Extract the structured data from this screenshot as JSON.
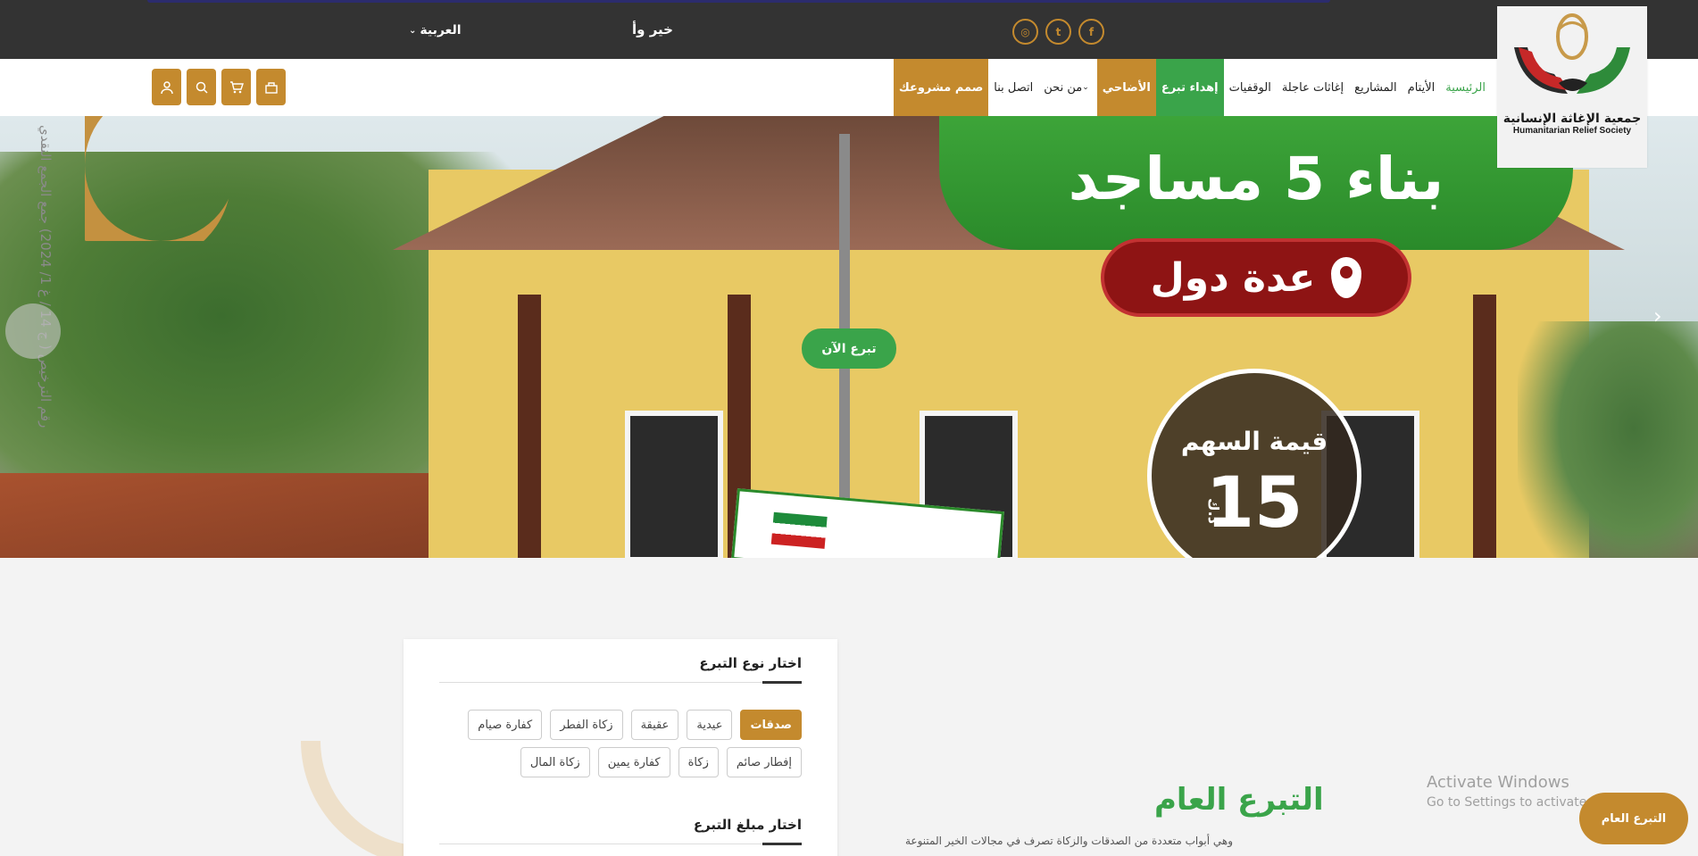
{
  "topbar": {
    "language": "العربية",
    "slogan": "خير وأ",
    "social": [
      {
        "icon": "facebook-icon",
        "glyph": "f"
      },
      {
        "icon": "twitter-icon",
        "glyph": "t"
      },
      {
        "icon": "instagram-icon",
        "glyph": "◎"
      }
    ]
  },
  "logo": {
    "name_ar": "جمعية الإغاثة الإنسانية",
    "name_en": "Humanitarian Relief Society"
  },
  "nav": {
    "items": [
      {
        "label": "الرئيسية",
        "style": "active"
      },
      {
        "label": "الأيتام",
        "style": ""
      },
      {
        "label": "المشاريع",
        "style": ""
      },
      {
        "label": "إغاثات عاجلة",
        "style": ""
      },
      {
        "label": "الوقفيات",
        "style": ""
      },
      {
        "label": "إهداء تبرع",
        "style": "green"
      },
      {
        "label": "الأضاحي",
        "style": "gold"
      },
      {
        "label": "من نحن",
        "style": "dropdown"
      },
      {
        "label": "اتصل بنا",
        "style": ""
      },
      {
        "label": "صمم مشروعك",
        "style": "gold"
      }
    ],
    "tools": [
      "donate-box-icon",
      "cart-icon",
      "search-icon",
      "user-icon"
    ]
  },
  "hero": {
    "headline": "بناء 5 مساجد",
    "location": "عدة دول",
    "share_label": "قيمة السهم",
    "share_value": "15",
    "share_unit": "د.ك",
    "license_text": "رقم الترخيص ( ج 14 / غ 1/ 2024) جمع الجمع النقدي",
    "donate_now": "تبرع الآن"
  },
  "donation_card": {
    "type_heading": "اختار نوع التبرع",
    "types": [
      "صدقات",
      "عيدية",
      "عقيقة",
      "زكاة الفطر",
      "كفارة صيام",
      "إفطار صائم",
      "زكاة",
      "كفارة يمين",
      "زكاة المال"
    ],
    "selected_type": "صدقات",
    "amount_heading": "اختار مبلغ التبرع"
  },
  "general": {
    "title": "التبرع العام",
    "description": "وهي أبواب متعددة من الصدقات والزكاة تصرف في مجالات الخير المتنوعة"
  },
  "overlay": {
    "activate_title": "Activate Windows",
    "activate_sub": "Go to Settings to activate Windows.",
    "floating_button": "التبرع العام"
  },
  "colors": {
    "gold": "#c48a2e",
    "green": "#3aa44a",
    "topbar": "#333333"
  }
}
